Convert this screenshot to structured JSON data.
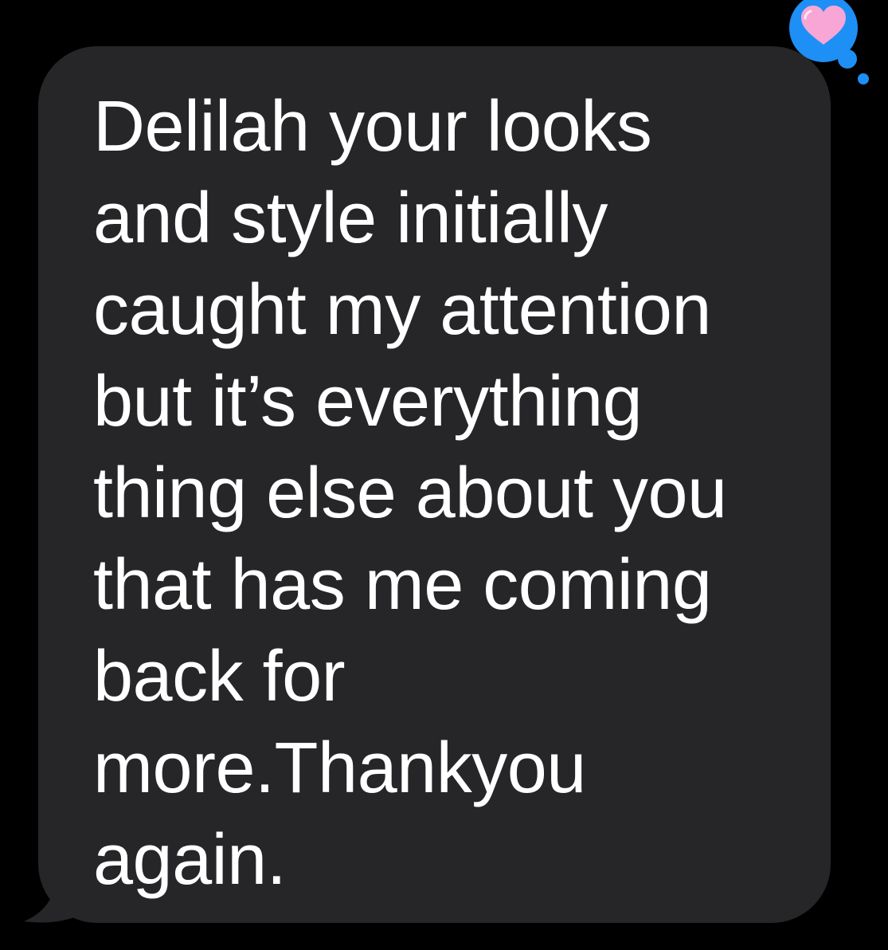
{
  "message": {
    "lines": [
      "Delilah your looks",
      "and style initially",
      "caught my attention",
      "but it’s everything",
      "thing else about you",
      "that has me coming",
      "back for",
      "more.Thankyou",
      "again."
    ],
    "bubble_color": "#262628",
    "text_color": "#ffffff"
  },
  "tapback": {
    "icon": "heart-icon",
    "bubble_color": "#1e8ff5",
    "heart_color": "#f7a6d6"
  },
  "background_color": "#000000"
}
